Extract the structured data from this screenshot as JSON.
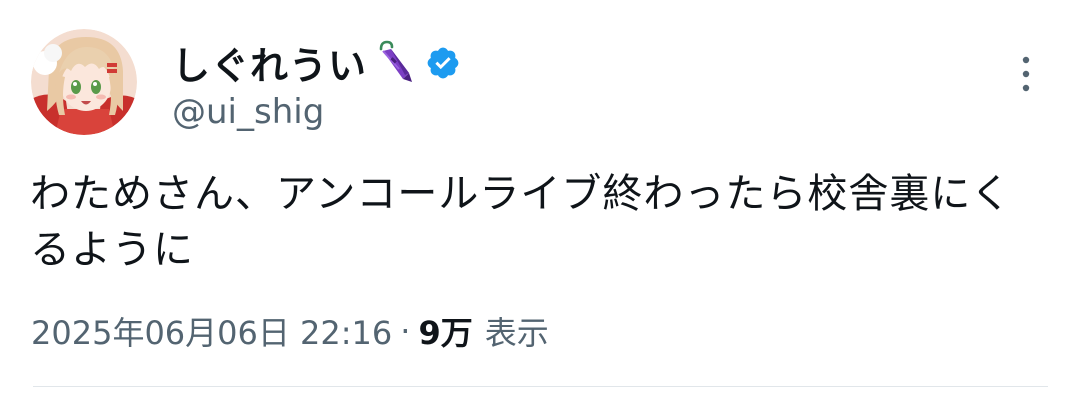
{
  "tweet": {
    "display_name": "しぐれうい",
    "name_emoji": "umbrella-icon",
    "verified": true,
    "handle": "@ui_shig",
    "text": "わためさん、アンコールライブ終わったら校舎裏にくるように",
    "timestamp": "2025年06月06日 22:16",
    "separator": "·",
    "views_count": "9万",
    "views_label": "表示"
  },
  "colors": {
    "text_primary": "#0f1419",
    "text_secondary": "#536471",
    "verified_blue": "#1d9bf0",
    "divider": "#e1e6ea",
    "umbrella_purple": "#7b3fc4"
  },
  "icons": {
    "avatar": "avatar-image",
    "verified": "verified-badge-icon",
    "more": "more-vertical-icon"
  }
}
